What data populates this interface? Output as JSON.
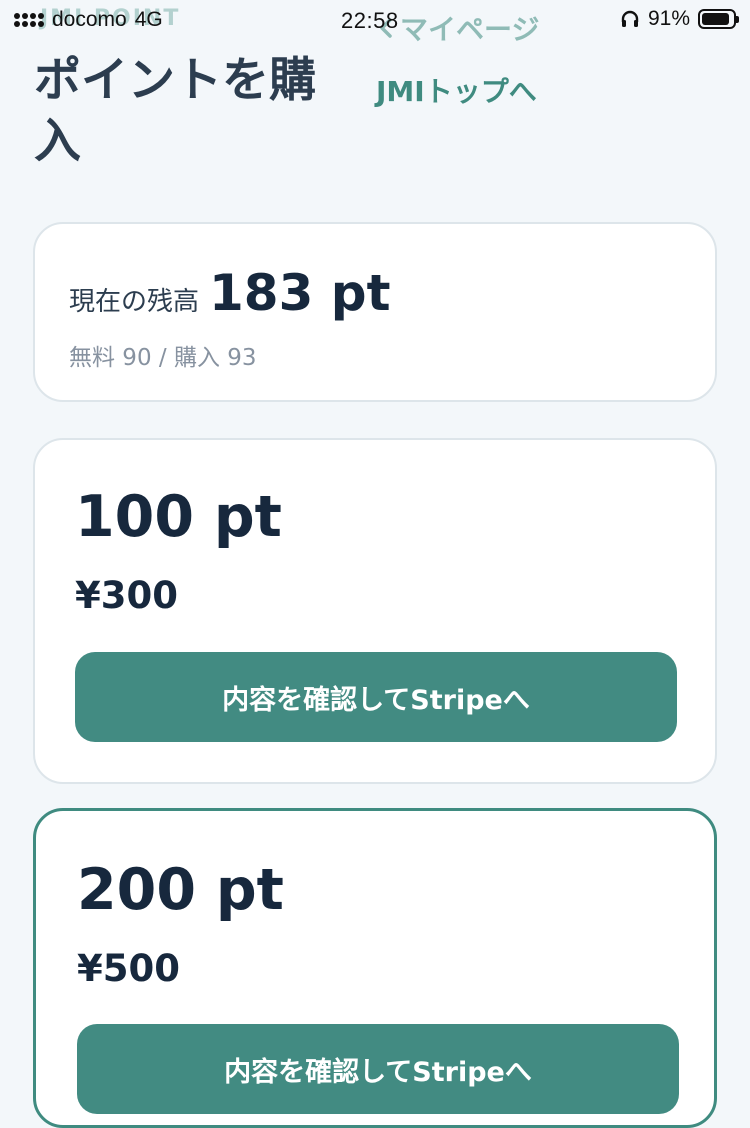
{
  "status_bar": {
    "carrier": "docomo",
    "network": "4G",
    "time": "22:58",
    "battery": "91%",
    "battery_level": 0.91
  },
  "header": {
    "brand": "JMI POINT",
    "back_link": "マイページ",
    "title": "ポイントを購入",
    "top_link": "JMIトップへ"
  },
  "balance": {
    "label": "現在の残高",
    "value": "183 pt",
    "detail": "無料 90 / 購入 93"
  },
  "packages": [
    {
      "points": "100 pt",
      "price": "¥300",
      "button_label": "内容を確認してStripeへ"
    },
    {
      "points": "200 pt",
      "price": "¥500",
      "button_label": "内容を確認してStripeへ"
    }
  ],
  "colors": {
    "accent": "#428b82",
    "text": "#17283d",
    "background": "#f3f7fa"
  }
}
